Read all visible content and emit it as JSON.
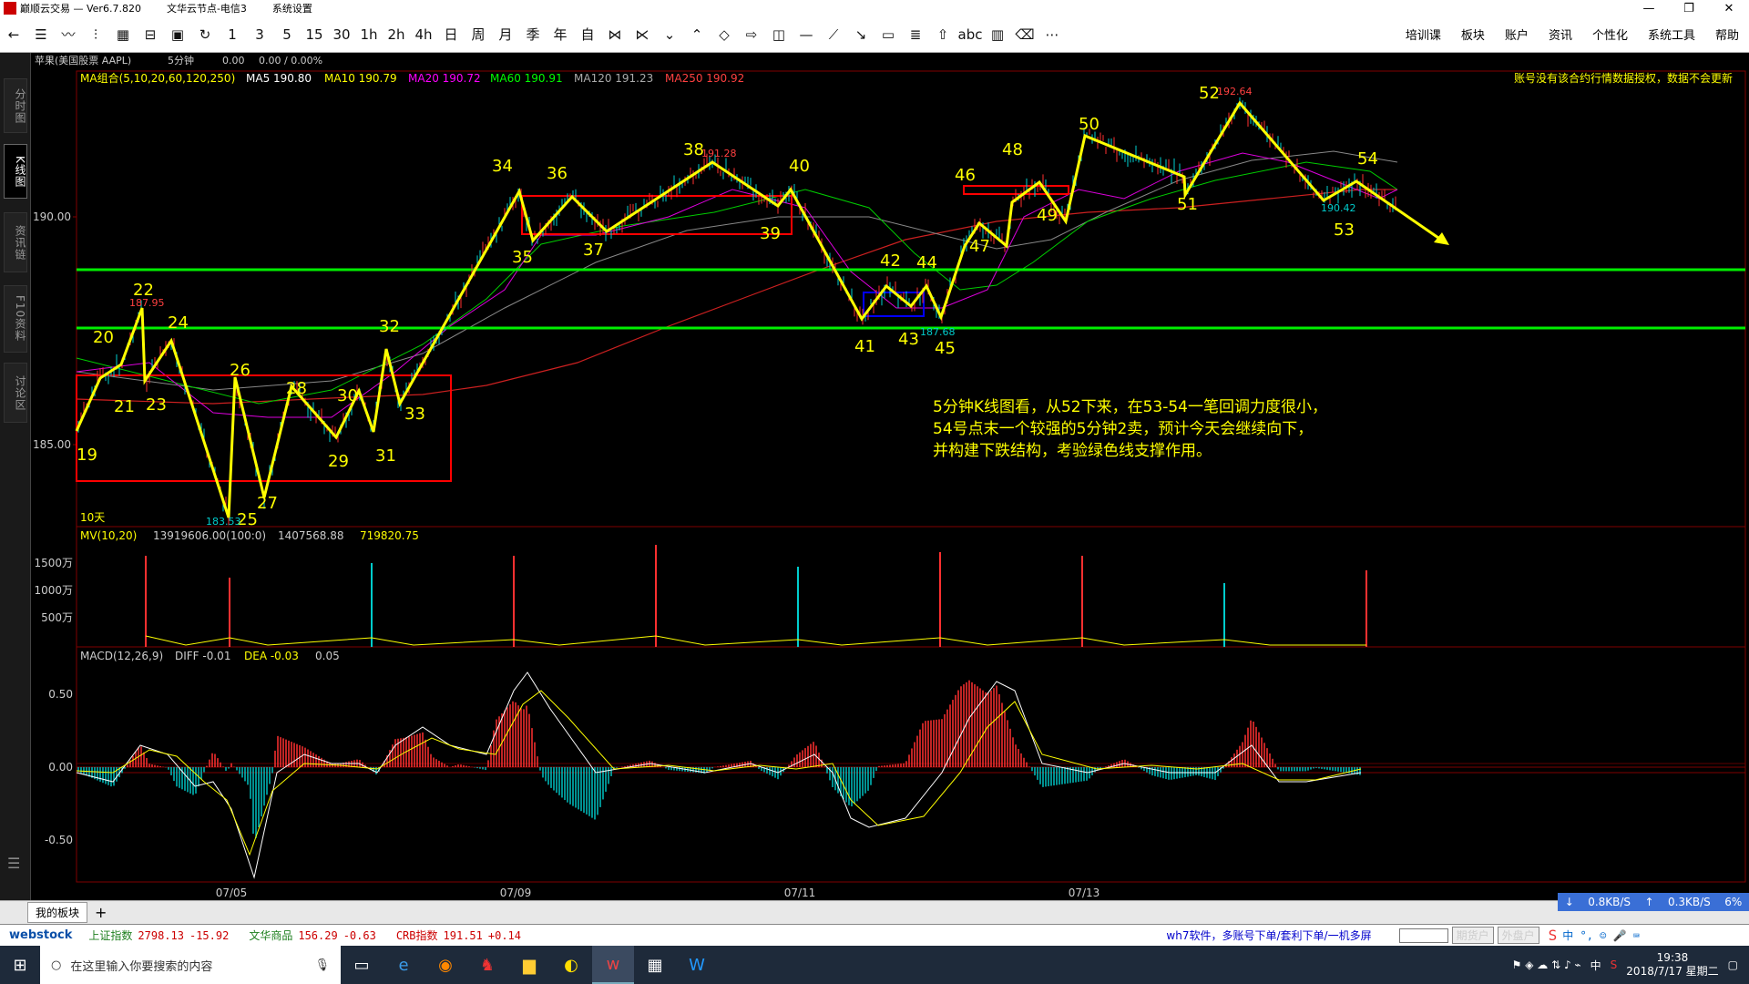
{
  "titlebar": {
    "app": "巅顺云交易 — Ver6.7.820",
    "server": "文华云节点-电信3",
    "menu": "系统设置"
  },
  "toolbar": {
    "periods": [
      "1",
      "3",
      "5",
      "15",
      "30",
      "1h",
      "2h",
      "4h",
      "日",
      "周",
      "月",
      "季",
      "年",
      "自"
    ],
    "menus": [
      "培训课",
      "板块",
      "账户",
      "资讯",
      "个性化",
      "系统工具",
      "帮助"
    ]
  },
  "side_tabs": [
    "分时图",
    "K线图",
    "资讯链",
    "F10资料",
    "讨论区"
  ],
  "header": {
    "instrument": "苹果(美国股票 AAPL)",
    "period": "5分钟",
    "price": "0.00",
    "change": "0.00 / 0.00%",
    "warning": "账号没有该合约行情数据授权，数据不会更新"
  },
  "ma": {
    "label": "MA组合(5,10,20,60,120,250)",
    "items": [
      {
        "text": "MA5 190.80",
        "color": "#ffffff"
      },
      {
        "text": "MA10 190.79",
        "color": "#ffff00"
      },
      {
        "text": "MA20 190.72",
        "color": "#ff00ff"
      },
      {
        "text": "MA60 190.91",
        "color": "#00ff00"
      },
      {
        "text": "MA120 191.23",
        "color": "#aaaaaa"
      },
      {
        "text": "MA250 190.92",
        "color": "#ff4040"
      }
    ]
  },
  "price_axis": [
    "190.00",
    "185.00"
  ],
  "period_label": "10天",
  "mv": {
    "label": "MV(10,20)",
    "v1": "13919606.00(100:0)",
    "v2": "1407568.88",
    "v3": "719820.75",
    "axis": [
      "1500万",
      "1000万",
      "500万"
    ]
  },
  "macd": {
    "label": "MACD(12,26,9)",
    "diff": "DIFF -0.01",
    "dea": "DEA -0.03",
    "val": "0.05",
    "axis": [
      "0.50",
      "0.00",
      "-0.50"
    ]
  },
  "dates": [
    "07/05",
    "07/09",
    "07/11",
    "07/13"
  ],
  "wave_labels": [
    "19",
    "20",
    "21",
    "22",
    "23",
    "24",
    "25",
    "26",
    "27",
    "28",
    "29",
    "30",
    "31",
    "32",
    "33",
    "34",
    "35",
    "36",
    "37",
    "38",
    "39",
    "40",
    "41",
    "42",
    "43",
    "44",
    "45",
    "46",
    "47",
    "48",
    "49",
    "50",
    "51",
    "52",
    "53",
    "54"
  ],
  "price_marks": [
    "187.95",
    "183.53",
    "191.28",
    "187.68",
    "192.64",
    "190.42"
  ],
  "annotation": [
    "5分钟K线图看，从52下来，在53-54一笔回调力度很小，",
    "54号点末一个较强的5分钟2卖，预计今天会继续向下，",
    "并构建下跌结构，考验绿色线支撑作用。"
  ],
  "footer": {
    "tab": "我的板块",
    "add": "+"
  },
  "speed": {
    "down": "0.8KB/S",
    "up": "0.3KB/S",
    "pct": "6%"
  },
  "ticker": {
    "logo": "webstock",
    "items": [
      {
        "name": "上证指数",
        "value": "2798.13",
        "change": "-15.92"
      },
      {
        "name": "文华商品",
        "value": "156.29",
        "change": "-0.63"
      },
      {
        "name": "CRB指数",
        "value": "191.51",
        "change": "+0.14"
      }
    ],
    "ad": "wh7软件，多账号下单/套利下单/一机多屏",
    "btn1": "期货户",
    "btn2": "外盘户"
  },
  "taskbar": {
    "search_placeholder": "在这里输入你要搜索的内容",
    "time": "19:38",
    "date": "2018/7/17 星期二",
    "ime": "中"
  }
}
